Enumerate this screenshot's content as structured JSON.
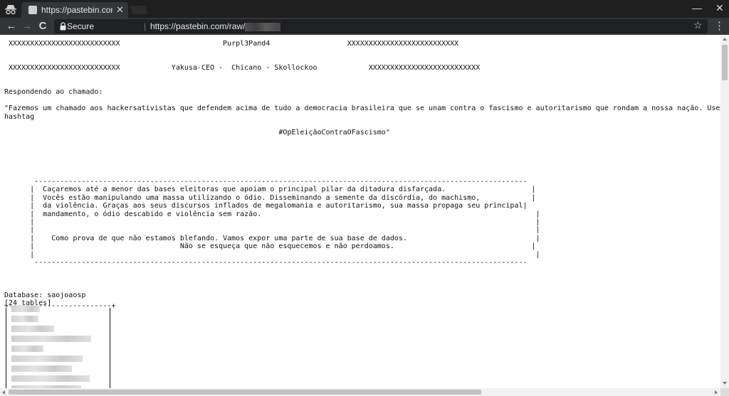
{
  "browser": {
    "tab_title": "https://pastebin.com",
    "close_glyph": "✕",
    "minimize_glyph": "—",
    "window_close_glyph": "✕",
    "back_glyph": "←",
    "forward_glyph": "→",
    "reload_glyph": "C",
    "secure_label": "Secure",
    "url_prefix": "https://pastebin.com/raw/",
    "star_glyph": "☆",
    "menu_glyph": "⋮"
  },
  "document": {
    "text": " XXXXXXXXXXXXXXXXXXXXXXXXXX                        Purpl3Pand4                  XXXXXXXXXXXXXXXXXXXXXXXXXX\n\n\n XXXXXXXXXXXXXXXXXXXXXXXXXX            Yakusa-CEO -  Chicano - Skollockoo            XXXXXXXXXXXXXXXXXXXXXXXXXX\n\n\nRespondendo ao chamado:\n\n\"Fazemos um chamado aos hackersativistas que defendem acima de tudo a democracia brasileira que se unam contra o fascismo e autoritarismo que rondam a nossa nação. Usem a\nhashtag\n\n                                                                #OpEleiçãoContraOFascismo\"\n\n\n\n\n\n       -------------------------------------------------------------------------------------------------------------------\n      |  Caçaremos até a menor das bases eleitoras que apoiam o principal pilar da ditadura disfarçada.                    |\n      |  Vocês estão manipulando uma massa utilizando o ódio. Disseminando a semente da discórdia, do machismo,            |\n      |  da violência. Graças aos seus discursos inflados de megalomania e autoritarismo, sua massa propaga seu principal|\n      |  mandamento, o ódio descabido e violência sem razão.                                                                |\n      |                                                                                                                     |\n      |                                                                                                                     |\n      |    Como prova de que não estamos blefando. Vamos expor uma parte de sua base de dados.                              |\n      |                                  Não se esqueça que não esquecemos e não perdoamos.                                |\n      |                                                                                                                     |\n       -------------------------------------------------------------------------------------------------------------------\n\n\n\nDatabase: saojoaosp\n[24 tables]",
    "table_border_top": "+------------------------+"
  }
}
